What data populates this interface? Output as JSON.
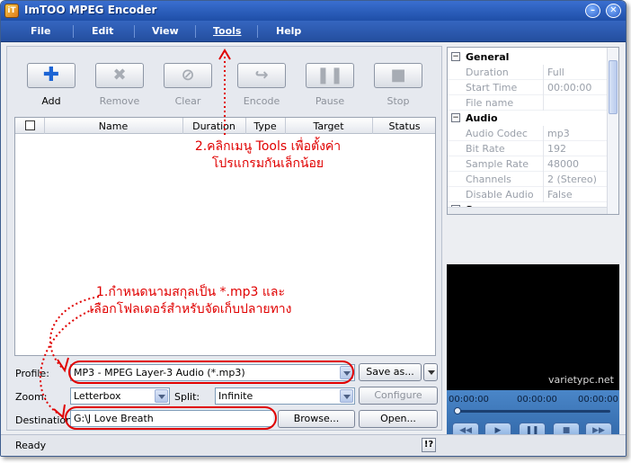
{
  "window": {
    "title": "ImTOO MPEG Encoder",
    "app_icon_glyph": "iT"
  },
  "menu": [
    {
      "label": "File"
    },
    {
      "label": "Edit"
    },
    {
      "label": "View"
    },
    {
      "label": "Tools"
    },
    {
      "label": "Help"
    }
  ],
  "toolbar": {
    "add": {
      "label": "Add",
      "icon": "plus-icon"
    },
    "remove": {
      "label": "Remove",
      "icon": "x-icon"
    },
    "clear": {
      "label": "Clear",
      "icon": "no-entry-icon"
    },
    "encode": {
      "label": "Encode",
      "icon": "arrow-icon"
    },
    "pause": {
      "label": "Pause",
      "icon": "pause-icon"
    },
    "stop": {
      "label": "Stop",
      "icon": "stop-icon"
    }
  },
  "file_list": {
    "columns": [
      "Name",
      "Duration",
      "Type",
      "Target",
      "Status"
    ],
    "rows": []
  },
  "profile": {
    "label": "Profile:",
    "value": "MP3 - MPEG Layer-3 Audio  (*.mp3)",
    "save_as_label": "Save as..."
  },
  "zoom": {
    "label": "Zoom:",
    "value": "Letterbox"
  },
  "split": {
    "label": "Split:",
    "value": "Infinite"
  },
  "configure_label": "Configure",
  "destination": {
    "label": "Destination:",
    "value": "G:\\J Love Breath",
    "browse_label": "Browse...",
    "open_label": "Open..."
  },
  "properties": {
    "general": {
      "title": "General",
      "rows": [
        {
          "key": "Duration",
          "value": "Full"
        },
        {
          "key": "Start Time",
          "value": "00:00:00"
        },
        {
          "key": "File name",
          "value": ""
        }
      ]
    },
    "audio": {
      "title": "Audio",
      "rows": [
        {
          "key": "Audio Codec",
          "value": "mp3"
        },
        {
          "key": "Bit Rate",
          "value": "192"
        },
        {
          "key": "Sample Rate",
          "value": "48000"
        },
        {
          "key": "Channels",
          "value": "2 (Stereo)"
        },
        {
          "key": "Disable Audio",
          "value": "False"
        }
      ]
    },
    "summary": {
      "title": "Summary"
    }
  },
  "preview": {
    "watermark": "varietypc.net"
  },
  "player": {
    "time_left": "00:00:00",
    "time_mid": "00:00:00",
    "time_right": "00:00:00"
  },
  "status": {
    "text": "Ready",
    "help_label": "!?"
  },
  "annotations": {
    "tools_note": "2.คลิกเมนู Tools เพื่อตั้งค่าโปรแกรมกันเล็กน้อย",
    "profile_note": "1.กำหนดนามสกุลเป็น *.mp3 และเลือกโฟลเดอร์สำหรับจัดเก็บปลายทาง",
    "color": "#e00000"
  },
  "colors": {
    "titlebar": "#2a5cc0",
    "menubar": "#3566c0",
    "accent": "#1c64d4"
  }
}
